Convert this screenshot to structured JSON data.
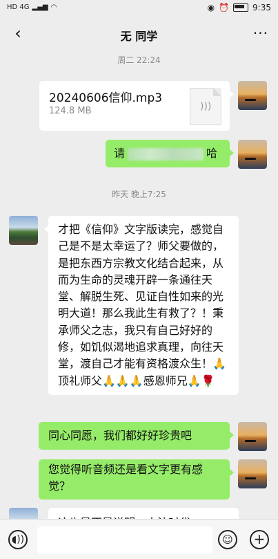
{
  "status_bar": {
    "network": "HD 4G",
    "time": "9:35"
  },
  "header": {
    "title": "无 同学",
    "back_glyph": "‹",
    "more_glyph": "···"
  },
  "messages": [
    {
      "type": "timestamp",
      "text": "周二 22:24"
    },
    {
      "type": "file",
      "side": "me",
      "file_name": "20240606信仰.mp3",
      "file_size": "124.8 MB"
    },
    {
      "type": "text",
      "side": "me",
      "prefix": "请",
      "suffix": "哈"
    },
    {
      "type": "timestamp",
      "text": "昨天 晚上7:25"
    },
    {
      "type": "text",
      "side": "them",
      "text": "才把《信仰》文字版读完，感觉自己是不是太幸运了？师父要做的，是把东西方宗教文化结合起来，从而为生命的灵魂开辟一条通往天堂、解脱生死、见证自性如来的光明大道！那么我此生有救了？！秉承师父之志，我只有自己好好的修，如饥似渴地追求真理，向往天堂，渡自己才能有资格渡众生！🙏顶礼师父🙏🙏🙏感恩师兄🙏🌹"
    },
    {
      "type": "text",
      "side": "me",
      "text": "同心同愿，我们都好好珍贵吧"
    },
    {
      "type": "text",
      "side": "me",
      "text": "您觉得听音频还是看文字更有感觉？"
    },
    {
      "type": "text",
      "side": "them",
      "text": "这也是不是说明，末法时代"
    }
  ],
  "input_bar": {
    "placeholder": ""
  }
}
